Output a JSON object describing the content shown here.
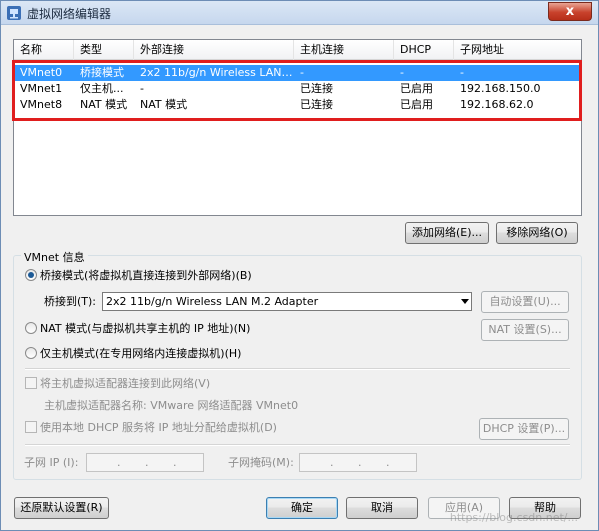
{
  "window": {
    "title": "虚拟网络编辑器",
    "close_label": "x"
  },
  "table": {
    "columns": [
      "名称",
      "类型",
      "外部连接",
      "主机连接",
      "DHCP",
      "子网地址"
    ],
    "rows": [
      {
        "name": "VMnet0",
        "type": "桥接模式",
        "external": "2x2 11b/g/n Wireless LAN M...",
        "host": "-",
        "dhcp": "-",
        "subnet": "-"
      },
      {
        "name": "VMnet1",
        "type": "仅主机...",
        "external": "-",
        "host": "已连接",
        "dhcp": "已启用",
        "subnet": "192.168.150.0"
      },
      {
        "name": "VMnet8",
        "type": "NAT 模式",
        "external": "NAT 模式",
        "host": "已连接",
        "dhcp": "已启用",
        "subnet": "192.168.62.0"
      }
    ]
  },
  "buttons": {
    "add_network": "添加网络(E)...",
    "remove_network": "移除网络(O)",
    "auto_settings": "自动设置(U)...",
    "nat_settings": "NAT 设置(S)...",
    "dhcp_settings": "DHCP 设置(P)...",
    "restore_defaults": "还原默认设置(R)",
    "ok": "确定",
    "cancel": "取消",
    "apply": "应用(A)",
    "help": "帮助"
  },
  "vmnet_info": {
    "group_title": "VMnet 信息",
    "bridged_label": "桥接模式(将虚拟机直接连接到外部网络)(B)",
    "bridged_to_label": "桥接到(T):",
    "bridged_to_value": "2x2 11b/g/n Wireless LAN M.2 Adapter",
    "nat_label": "NAT 模式(与虚拟机共享主机的 IP 地址)(N)",
    "host_only_label": "仅主机模式(在专用网络内连接虚拟机)(H)",
    "connect_adapter_label": "将主机虚拟适配器连接到此网络(V)",
    "adapter_name_label": "主机虚拟适配器名称: VMware 网络适配器 VMnet0",
    "use_dhcp_label": "使用本地 DHCP 服务将 IP 地址分配给虚拟机(D)",
    "subnet_ip_label": "子网 IP (I):",
    "subnet_mask_label": "子网掩码(M):",
    "ip_dots": ".",
    "selected_mode": "bridged"
  },
  "watermark": "https://blog.csdn.net/...",
  "colors": {
    "selection": "#3399ff",
    "highlight_border": "#e01e1e"
  }
}
